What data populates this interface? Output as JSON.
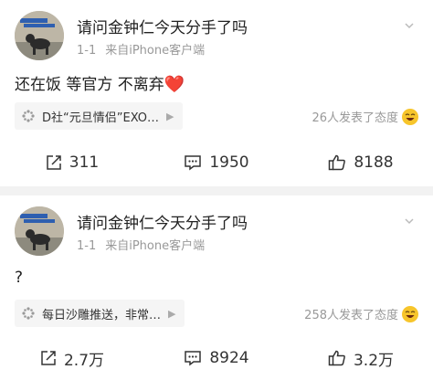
{
  "posts": [
    {
      "username": "请问金钟仁今天分手了吗",
      "date": "1-1",
      "source": "来自iPhone客户端",
      "content": "还在饭 等官方 不离弃",
      "content_emoji": "❤️",
      "topic": "D社“元旦情侣”EXO…",
      "attitude": "26人发表了态度",
      "reposts": "311",
      "comments": "1950",
      "likes": "8188"
    },
    {
      "username": "请问金钟仁今天分手了吗",
      "date": "1-1",
      "source": "来自iPhone客户端",
      "content": "?",
      "content_emoji": "",
      "topic": "每日沙雕推送，非常…",
      "attitude": "258人发表了态度",
      "reposts": "2.7万",
      "comments": "8924",
      "likes": "3.2万"
    }
  ],
  "icons": {
    "repost": "repost-icon",
    "comment": "comment-icon",
    "like": "like-icon",
    "topic": "topic-icon",
    "dropdown": "chevron-down-icon"
  },
  "colors": {
    "meta": "#999999",
    "heart": "#e0332e",
    "emoji": "#f7c52b"
  }
}
